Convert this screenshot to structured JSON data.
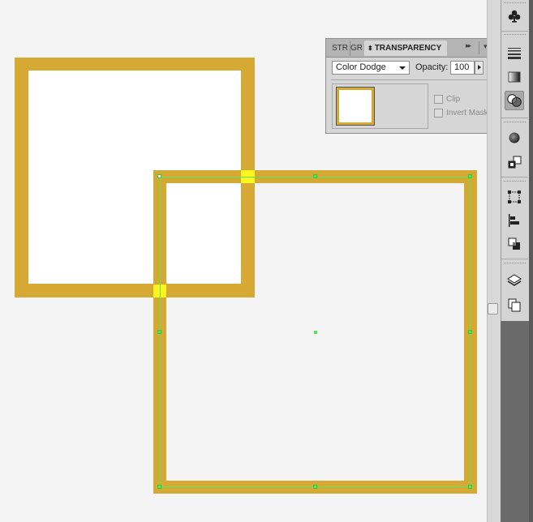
{
  "panel": {
    "tabs": [
      {
        "label": "STR"
      },
      {
        "label": "GRA"
      },
      {
        "label": "TRANSPARENCY",
        "active": true
      }
    ],
    "blend_mode": "Color Dodge",
    "opacity_label": "Opacity:",
    "opacity_value": "100",
    "opacity_unit": "%",
    "clip_label": "Clip",
    "invert_mask_label": "Invert Mask",
    "forward_icon": "▸▸",
    "menu_icon": "▾≡",
    "updown_icon": "⬍"
  },
  "colors": {
    "stroke_gold": "#d6a934",
    "dodge_yellow": "#fff51f",
    "selection_green": "#58e65a",
    "canvas_bg": "#f4f4f4",
    "panel_bg": "#d6d6d6"
  },
  "toolbar": {
    "icons": [
      "club-icon",
      "stroke-lines-icon",
      "gradient-icon",
      "transparency-icon",
      "appearance-icon",
      "graphic-styles-icon",
      "transform-icon",
      "align-icon",
      "pathfinder-icon",
      "layers-icon",
      "artboards-icon"
    ],
    "active_icon": "transparency-icon"
  }
}
